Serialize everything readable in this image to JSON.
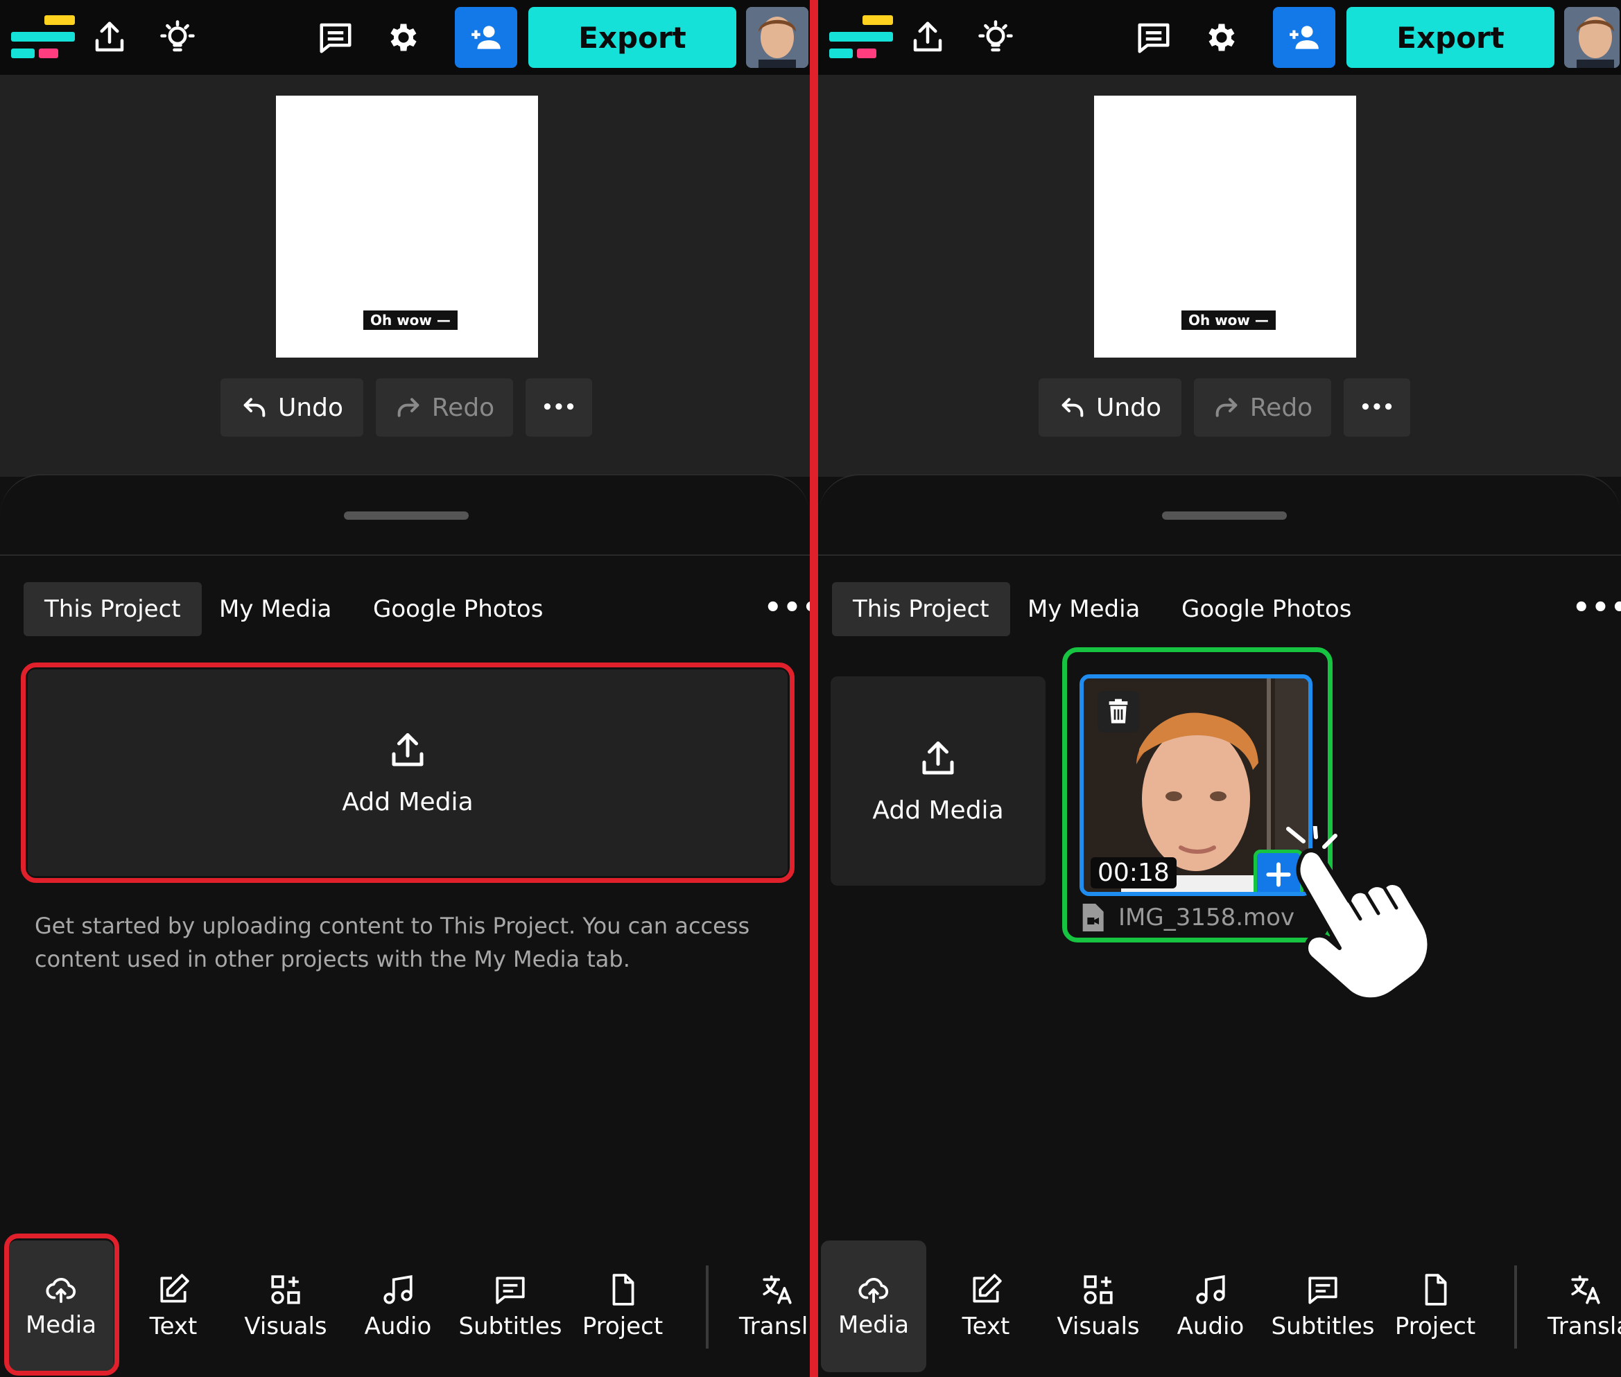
{
  "topbar": {
    "export_label": "Export",
    "icons": [
      "upload-icon",
      "lightbulb-icon",
      "comment-icon",
      "gear-icon",
      "add-user-icon"
    ]
  },
  "preview": {
    "caption": "Oh wow —",
    "undo_label": "Undo",
    "redo_label": "Redo",
    "more_label": "•••"
  },
  "media_panel": {
    "tabs": [
      {
        "label": "This Project",
        "active": true
      },
      {
        "label": "My Media",
        "active": false
      },
      {
        "label": "Google Photos",
        "active": false
      }
    ],
    "more_label": "•••",
    "add_media_label": "Add Media",
    "help_text": "Get started by uploading content to This Project. You can access content used in other projects with the My Media tab.",
    "media_item": {
      "duration": "00:18",
      "filename": "IMG_3158.mov"
    }
  },
  "bottom_nav": {
    "items": [
      {
        "label": "Media",
        "icon": "cloud-upload-icon",
        "active": true
      },
      {
        "label": "Text",
        "icon": "edit-icon"
      },
      {
        "label": "Visuals",
        "icon": "shapes-icon"
      },
      {
        "label": "Audio",
        "icon": "music-note-icon"
      },
      {
        "label": "Subtitles",
        "icon": "subtitles-icon"
      },
      {
        "label": "Project",
        "icon": "file-icon"
      },
      {
        "label": "Transl",
        "icon": "translate-icon"
      }
    ],
    "items_right_last": "Transla"
  },
  "colors": {
    "accent_teal": "#15e1d8",
    "accent_blue": "#1479e8",
    "highlight_red": "#e0212b",
    "highlight_green": "#16c442",
    "logo_yellow": "#ffd21f",
    "logo_pink": "#ff3d7f"
  }
}
